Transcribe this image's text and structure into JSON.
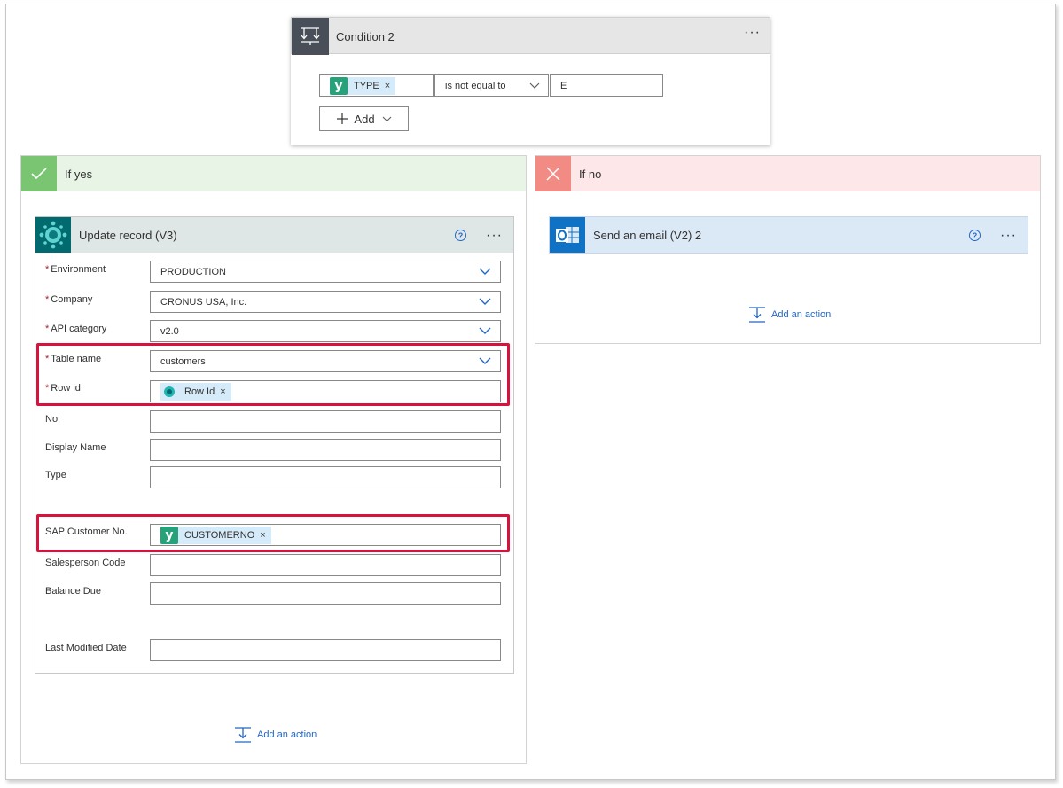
{
  "condition": {
    "title": "Condition 2",
    "left_token": "TYPE",
    "operator": "is not equal to",
    "value": "E",
    "add_label": "Add"
  },
  "if_yes": {
    "title": "If yes",
    "action": {
      "title": "Update record (V3)",
      "fields": [
        {
          "label": "Environment",
          "required": "*",
          "value": "PRODUCTION"
        },
        {
          "label": "Company",
          "required": "*",
          "value": "CRONUS USA, Inc."
        },
        {
          "label": "API category",
          "required": "*",
          "value": "v2.0"
        },
        {
          "label": "Table name",
          "required": "*",
          "value": "customers"
        },
        {
          "label": "Row id",
          "required": "*",
          "token": "Row Id"
        },
        {
          "label": "No.",
          "value": ""
        },
        {
          "label": "Display Name",
          "value": ""
        },
        {
          "label": "Type",
          "value": ""
        },
        {
          "label": "SAP Customer No.",
          "token": "CUSTOMERNO"
        },
        {
          "label": "Salesperson Code",
          "value": ""
        },
        {
          "label": "Balance Due",
          "value": ""
        },
        {
          "label": "Last Modified Date",
          "value": ""
        }
      ]
    },
    "add_action": "Add an action"
  },
  "if_no": {
    "title": "If no",
    "action": {
      "title": "Send an email (V2) 2"
    },
    "add_action": "Add an action"
  },
  "colors": {
    "yes_header": "#e8f5e6",
    "yes_icon": "#79c572",
    "no_header": "#fde7e9",
    "no_icon": "#f38b85",
    "update_header": "#dfe6e6",
    "update_icon": "#006a6f",
    "email_header": "#dbe9f6",
    "email_icon": "#0f72c4",
    "highlight": "#d6123d",
    "link": "#2266c2"
  },
  "icons": [
    "flow-condition-icon",
    "y-connector-icon",
    "check-icon",
    "x-icon",
    "business-central-icon",
    "outlook-icon",
    "help-icon",
    "more-icon",
    "add-action-icon",
    "chevron-down-icon"
  ]
}
